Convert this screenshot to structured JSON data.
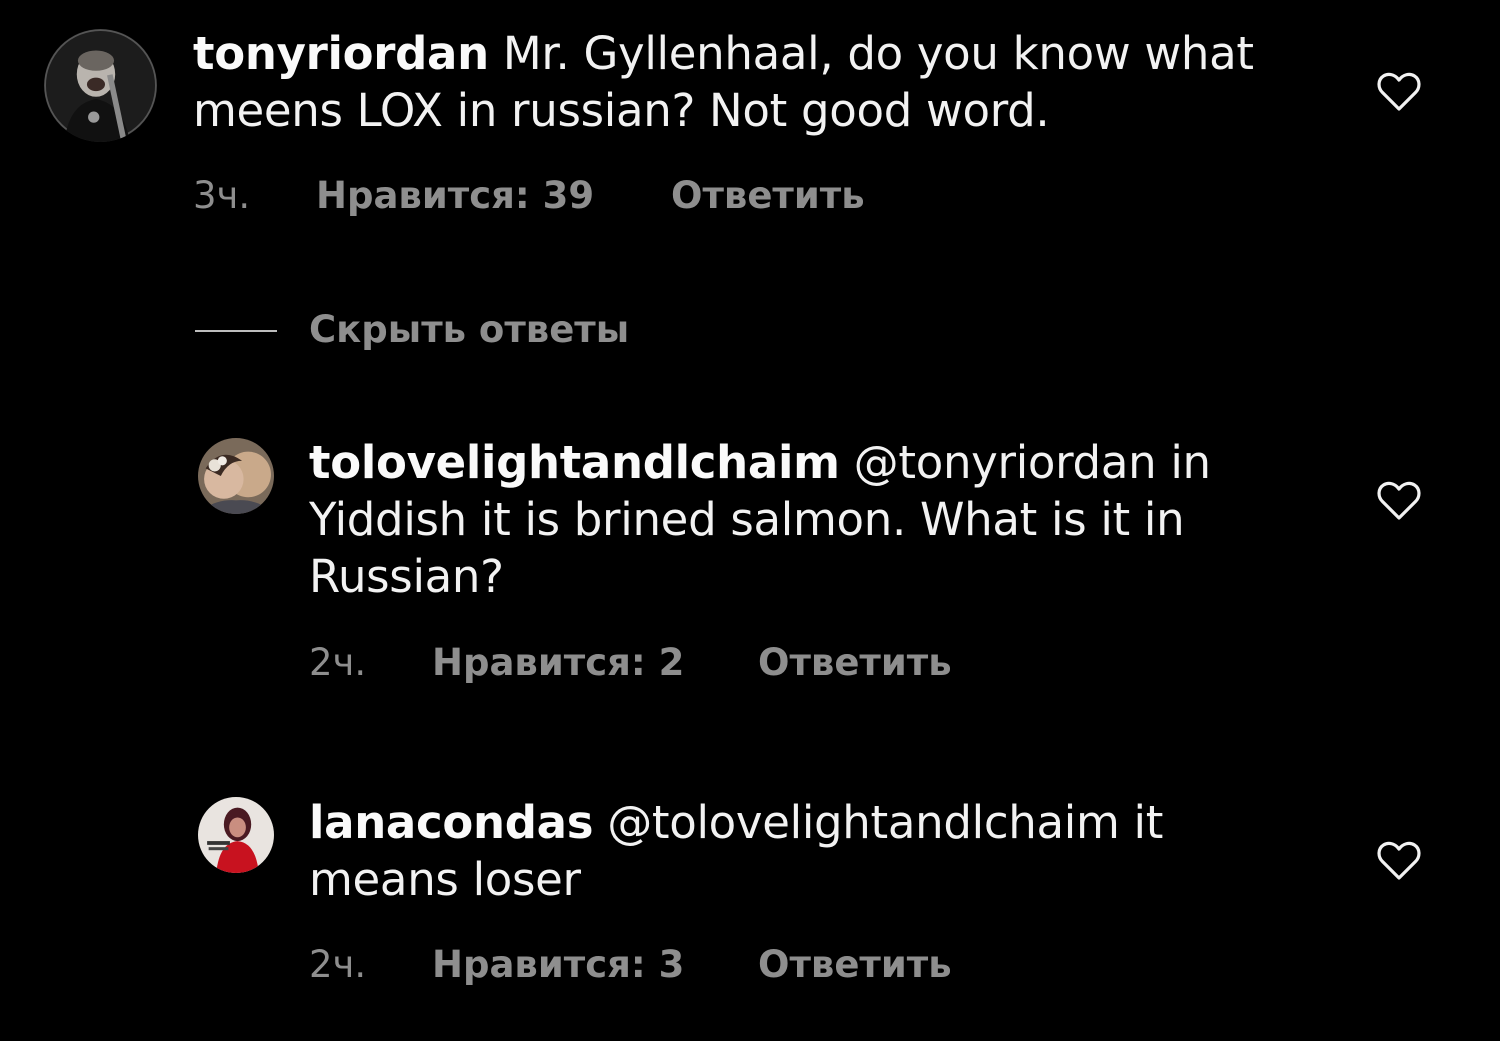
{
  "comments": [
    {
      "username": "tonyriordan",
      "text_line1": " Mr. Gyllenhaal, do you know what",
      "text_line2": "meens LOX in russian? Not good word.",
      "time": "3ч.",
      "likes": "Нравится: 39",
      "reply": "Ответить",
      "icons": {
        "avatar": "profile-photo",
        "like": "heart-outline-icon"
      }
    },
    {
      "username": "tolovelightandlchaim",
      "text_line1": " @tonyriordan in",
      "text_line2": "Yiddish it is brined salmon. What is it in",
      "text_line3": "Russian?",
      "time": "2ч.",
      "likes": "Нравится: 2",
      "reply": "Ответить",
      "icons": {
        "avatar": "profile-photo",
        "like": "heart-outline-icon"
      }
    },
    {
      "username": "lanacondas",
      "text_line1": " @tolovelightandlchaim it",
      "text_line2": "means loser",
      "time": "2ч.",
      "likes": "Нравится: 3",
      "reply": "Ответить",
      "icons": {
        "avatar": "profile-photo",
        "like": "heart-outline-icon"
      }
    }
  ],
  "hide_replies": {
    "label": "Скрыть ответы"
  },
  "colors": {
    "background": "#000000",
    "text": "#f2f2f2",
    "secondary": "#8e8e8e"
  }
}
